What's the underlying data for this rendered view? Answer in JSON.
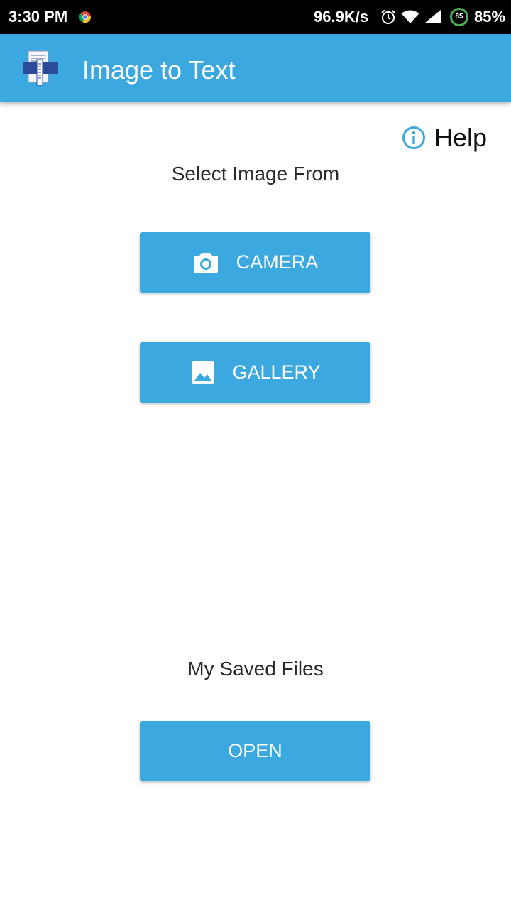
{
  "status_bar": {
    "time": "3:30 PM",
    "network_speed": "96.9K/s",
    "battery_level": "85",
    "battery_percent": "85%",
    "icons": [
      "chrome-icon",
      "alarm-icon",
      "wifi-icon",
      "signal-icon",
      "battery-icon"
    ]
  },
  "app_bar": {
    "title": "Image to Text",
    "logo_icon": "document-logo-icon",
    "color": "#3ca8e0"
  },
  "help": {
    "label": "Help",
    "icon": "info-icon"
  },
  "select_section": {
    "heading": "Select Image From",
    "camera_label": "CAMERA",
    "camera_icon": "camera-icon",
    "gallery_label": "GALLERY",
    "gallery_icon": "image-icon"
  },
  "saved_section": {
    "heading": "My Saved Files",
    "open_label": "OPEN"
  },
  "colors": {
    "accent": "#3ca8e0",
    "status_bar": "#000000",
    "battery_ring": "#4caf50"
  }
}
